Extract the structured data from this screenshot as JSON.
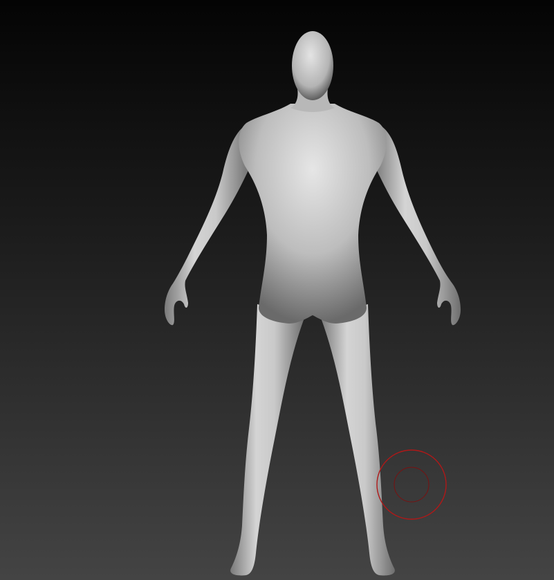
{
  "viewport": {
    "background_top_color": "#040404",
    "background_bottom_color": "#444444"
  },
  "model": {
    "type": "base-human-mesh",
    "pose": "A-pose",
    "material_color": "#c8c8c8"
  },
  "brush_cursor": {
    "outer_ring_color": "#b01818",
    "inner_ring_color": "#7a1010"
  }
}
